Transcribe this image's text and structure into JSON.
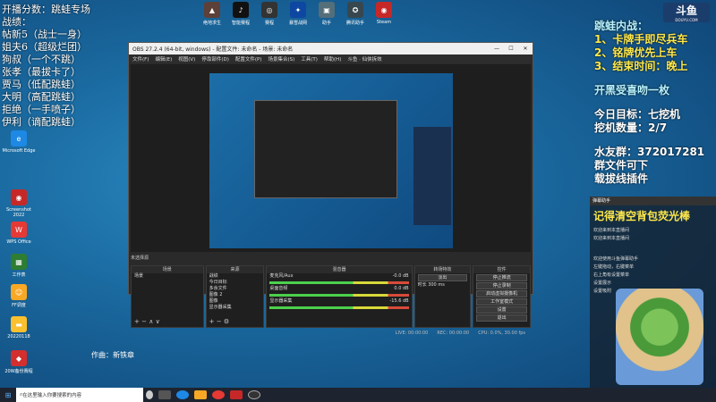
{
  "overlay_left": [
    "开播分数：跳蛙专场",
    "战绩：",
    "帖新5（战士一身）",
    "姐夫6（超级烂团）",
    "狗叔（一个不跳）",
    "张孝（最拔卡了）",
    "贾马（低配跳蛙）",
    "大明（高配跳蛙）",
    "拒绝（一手喷子）",
    "伊利（谪配跳蛙）"
  ],
  "overlay_right": {
    "line1": "跳蛙内战：",
    "items": [
      "1、卡牌手即尽兵车",
      "2、铭牌优先上车",
      "3、结束时间：晚上"
    ],
    "line2": "开黑受喜吻一枚",
    "goal": "今日目标：七挖机",
    "count": "挖机数量：2/7",
    "group": "水友群：372017281",
    "file": "群文件可下",
    "plugin": "载拔线插件"
  },
  "logo": {
    "main": "斗鱼",
    "sub": "DOUYU.COM"
  },
  "author": "作曲：新铁章",
  "desktop_icons": [
    "Microsoft Edge",
    "Screenshot 2022",
    "WPS Office",
    "工作表",
    "FF调度",
    "20220118",
    "20W备份赛程"
  ],
  "top_icons": [
    "绝地求生",
    "智能赛程",
    "赛程",
    "暴雪战网",
    "助手",
    "腾讯助手",
    "Steam"
  ],
  "obs": {
    "title": "OBS 27.2.4 (64-bit, windows) - 配置文件: 未命名 - 场景: 未命名",
    "menu": [
      "文件(F)",
      "编辑(E)",
      "视图(V)",
      "停靠部件(D)",
      "配置文件(P)",
      "场景集合(S)",
      "工具(T)",
      "帮助(H)",
      "斗鱼 · 仙侠拆效"
    ],
    "scene_label": "未选择源",
    "panels": {
      "scenes": {
        "title": "场景",
        "items": [
          "场景"
        ]
      },
      "sources": {
        "title": "来源",
        "items": [
          "战绩",
          "今日目标",
          "多余文件",
          "图像 2",
          "图像",
          "显示器采集"
        ]
      },
      "mixer": {
        "title": "混音器",
        "items": [
          "麦克风/Aux",
          "桌面音频",
          "显示器采集"
        ],
        "levels": [
          "-0.0 dB",
          "0.0 dB",
          "-15.6 dB"
        ]
      },
      "transitions": {
        "title": "转场特效",
        "fade": "淡出",
        "duration_label": "时长",
        "duration": "300 ms"
      },
      "controls": {
        "title": "控件",
        "buttons": [
          "停止推流",
          "停止录制",
          "启动虚拟摄像机",
          "工作室模式",
          "设置",
          "退出"
        ]
      }
    },
    "status": [
      "LIVE: 00:00:00",
      "REC: 00:00:00",
      "CPU: 0.0%, 30.00 fps"
    ]
  },
  "chat": {
    "header": "弹幕助手",
    "big": "记得清空背包荧光棒",
    "lines": [
      "欢迎来到本直播间",
      "欢迎来到本直播间",
      "欢迎使用斗鱼弹幕助手",
      "左键拖动，右键菜单",
      "右上角有设置菜单",
      "设置展示",
      "设置吸附"
    ]
  },
  "taskbar": {
    "search_placeholder": "在这里输入你要搜索的内容"
  }
}
